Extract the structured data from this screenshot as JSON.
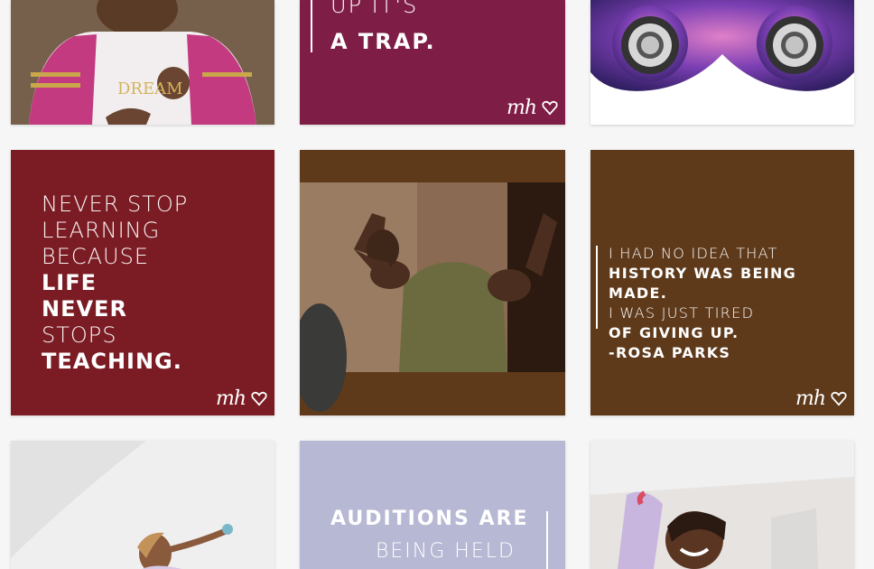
{
  "tiles": {
    "girl_dream": {
      "shirt_text": "DREAM"
    },
    "trap": {
      "line1": "UP IT'S",
      "line2": "A TRAP."
    },
    "never_stop": {
      "lines": [
        "NEVER STOP",
        "LEARNING",
        "BECAUSE",
        "LIFE",
        "NEVER",
        "STOPS",
        "TEACHING."
      ]
    },
    "rosa": {
      "lines": [
        "I HAD NO IDEA THAT",
        "HISTORY WAS BEING MADE.",
        "I WAS JUST TIRED",
        "OF GIVING UP.",
        "-ROSA PARKS"
      ]
    },
    "auditions": {
      "line1": "AUDITIONS ARE",
      "line2": "BEING HELD"
    },
    "logo_text": "mh"
  },
  "colors": {
    "page_bg": "#f6f6f6",
    "maroon": "#7b1c24",
    "plum": "#7e1d45",
    "brown": "#5e3a1b",
    "lavender": "#b7b8d3"
  }
}
